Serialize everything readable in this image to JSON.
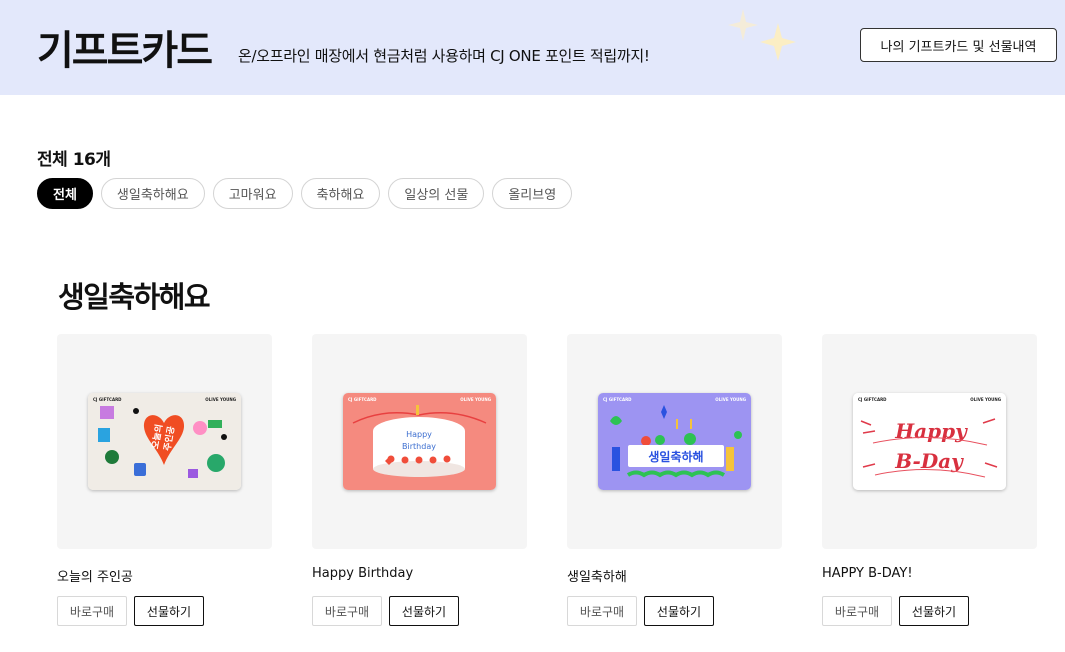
{
  "banner": {
    "title": "기프트카드",
    "description": "온/오프라인 매장에서 현금처럼 사용하며 CJ ONE 포인트 적립까지!",
    "history_button": "나의 기프트카드 및 선물내역"
  },
  "filter": {
    "total_label": "전체 16개",
    "chips": [
      "전체",
      "생일축하해요",
      "고마워요",
      "축하해요",
      "일상의 선물",
      "올리브영"
    ],
    "active_index": 0
  },
  "section": {
    "title": "생일축하해요"
  },
  "products": [
    {
      "name": "오늘의 주인공",
      "card_text": "오늘의 주인공",
      "buy": "바로구매",
      "gift": "선물하기"
    },
    {
      "name": "Happy Birthday",
      "card_text": "Happy Birthday",
      "buy": "바로구매",
      "gift": "선물하기"
    },
    {
      "name": "생일축하해",
      "card_text": "생일축하해",
      "buy": "바로구매",
      "gift": "선물하기"
    },
    {
      "name": "HAPPY B-DAY!",
      "card_text": "Happy B-Day",
      "buy": "바로구매",
      "gift": "선물하기"
    }
  ],
  "card_brand": {
    "left": "CJ GIFTCARD",
    "right": "OLIVE YOUNG"
  },
  "colors": {
    "banner_bg": "#e3e8fb",
    "chip_active": "#000000",
    "thumb_bg": "#f5f5f5"
  }
}
